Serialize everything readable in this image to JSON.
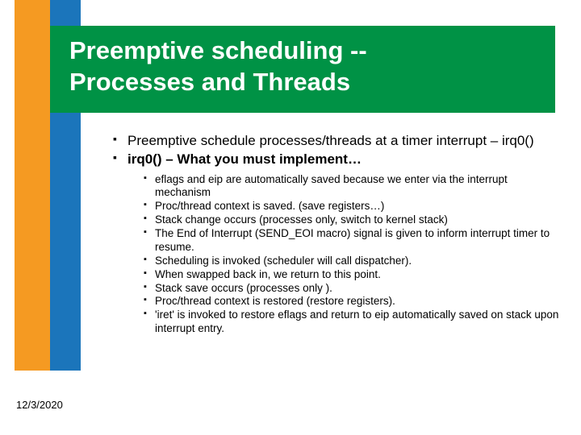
{
  "title_line1": "Preemptive scheduling --",
  "title_line2": "Processes and Threads",
  "bullets": {
    "main": [
      "Preemptive schedule processes/threads at a timer interrupt – irq0()",
      "irq0() – What you must implement…"
    ],
    "sub": [
      "eflags and eip are automatically saved because we enter via the interrupt mechanism",
      "Proc/thread context is saved. (save registers…)",
      "Stack change occurs (processes only, switch to kernel stack)",
      "The End of Interrupt (SEND_EOI macro) signal is given to inform interrupt timer to resume.",
      "Scheduling is invoked (scheduler will call dispatcher).",
      "When swapped back in, we return to this point.",
      "Stack save occurs (processes only ).",
      "Proc/thread context is restored (restore registers).",
      "'iret' is invoked to restore eflags and return to eip automatically saved on stack upon interrupt entry."
    ]
  },
  "footer_date": "12/3/2020"
}
